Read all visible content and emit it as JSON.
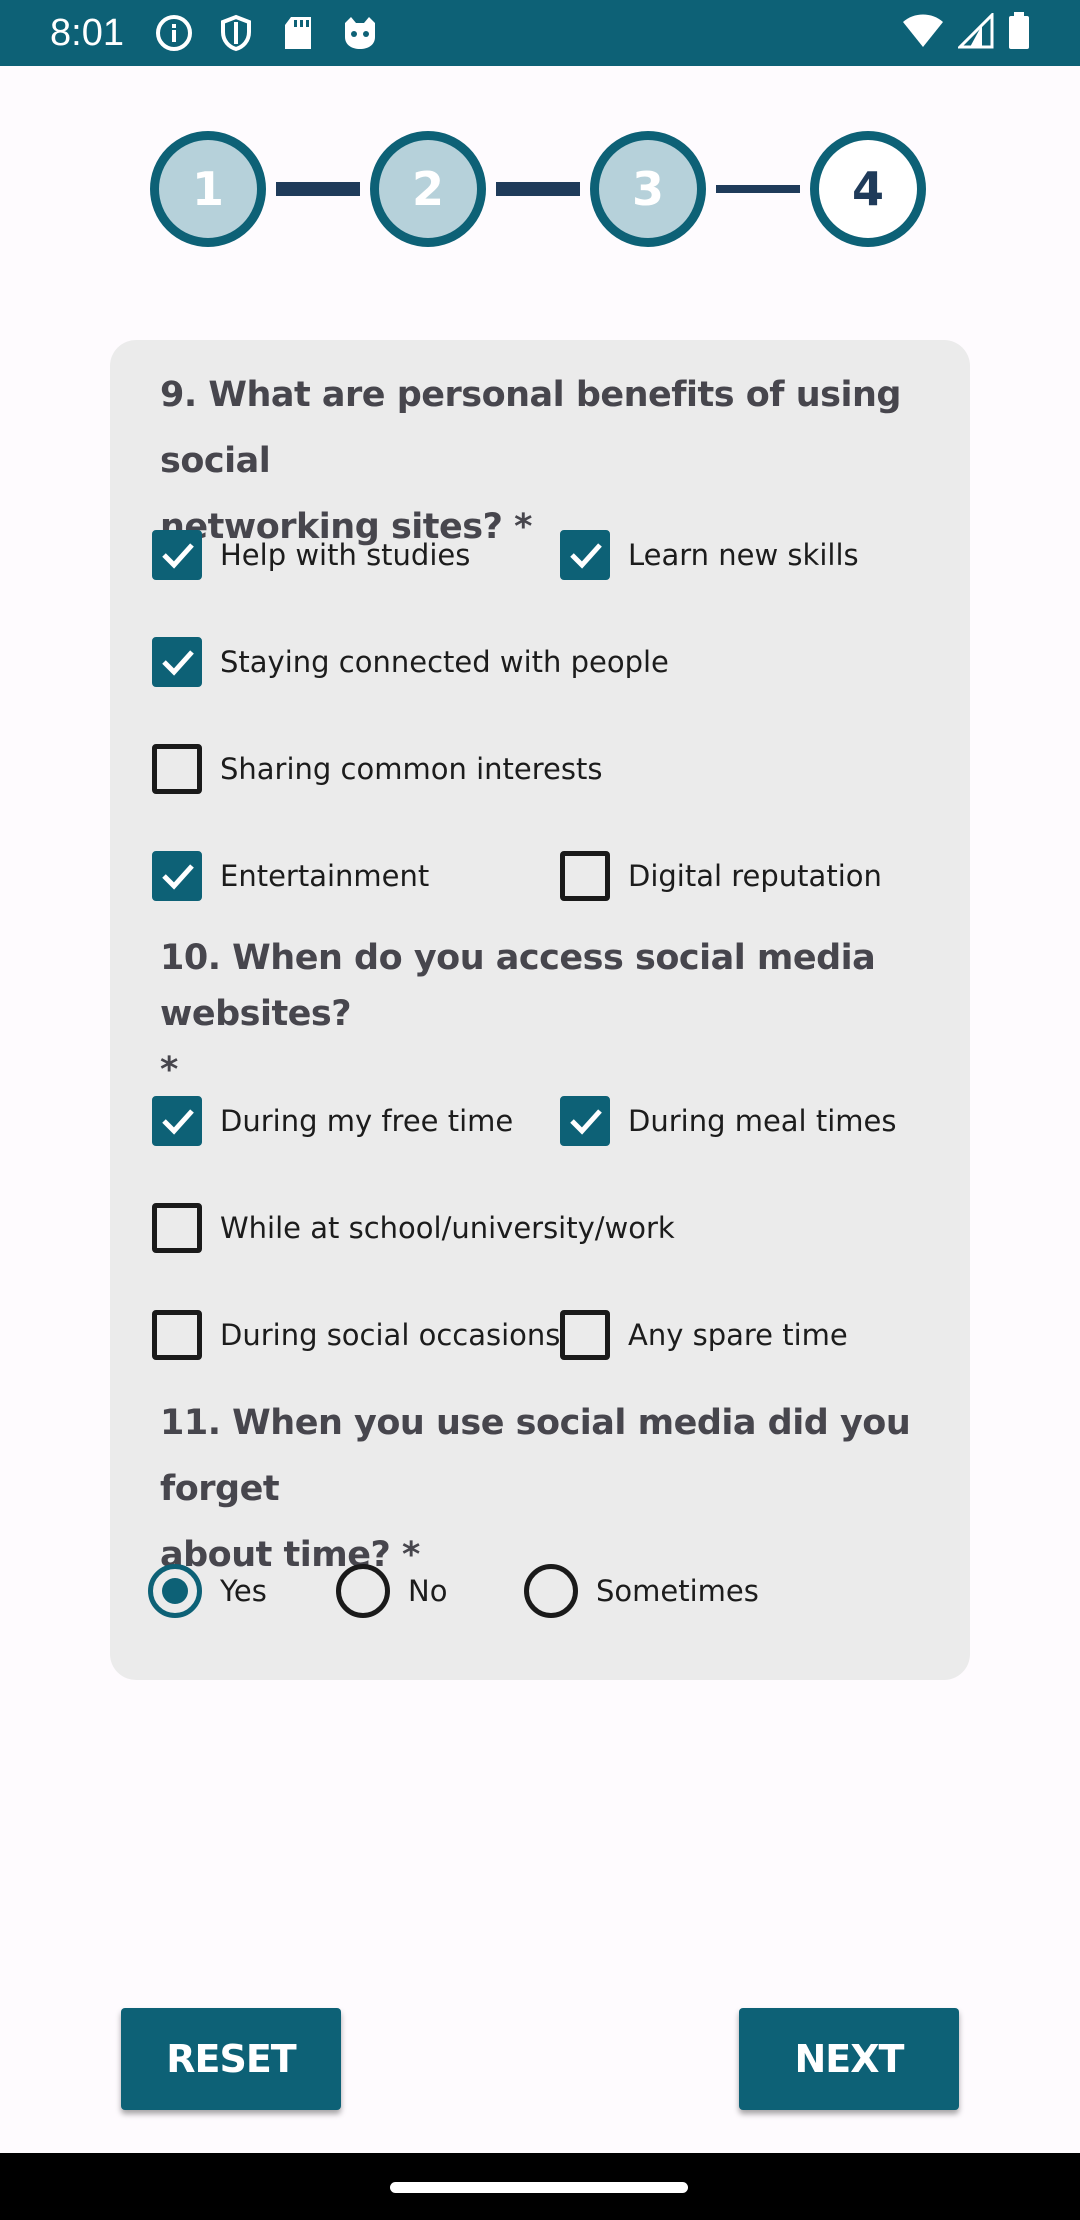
{
  "status_bar": {
    "time": "8:01",
    "left_icons": [
      "info-icon",
      "shield-icon",
      "sd-card-icon",
      "cat-face-icon"
    ],
    "right_icons": [
      "wifi-icon",
      "signal-icon",
      "battery-icon"
    ],
    "color": "#0d6176"
  },
  "stepper": {
    "steps": [
      {
        "label": "1",
        "state": "completed"
      },
      {
        "label": "2",
        "state": "completed"
      },
      {
        "label": "3",
        "state": "completed"
      },
      {
        "label": "4",
        "state": "active"
      }
    ]
  },
  "form": {
    "q9": {
      "line1": "9. What are personal benefits of using social",
      "line2": "networking sites? *",
      "options": [
        {
          "label": "Help with studies",
          "checked": true
        },
        {
          "label": "Learn new skills",
          "checked": true
        },
        {
          "label": "Staying connected with people",
          "checked": true
        },
        {
          "label": "Sharing common interests",
          "checked": false
        },
        {
          "label": "Entertainment",
          "checked": true
        },
        {
          "label": "Digital reputation",
          "checked": false
        }
      ]
    },
    "q10": {
      "line1": "10. When do you access social media websites?",
      "line2": "*",
      "options": [
        {
          "label": "During my free time",
          "checked": true
        },
        {
          "label": "During meal times",
          "checked": true
        },
        {
          "label": "While at school/university/work",
          "checked": false
        },
        {
          "label": "During social occasions",
          "checked": false
        },
        {
          "label": "Any spare time",
          "checked": false
        }
      ]
    },
    "q11": {
      "line1": "11. When you use social media did you forget",
      "line2": "about time? *",
      "options": [
        {
          "label": "Yes",
          "selected": true
        },
        {
          "label": "No",
          "selected": false
        },
        {
          "label": "Sometimes",
          "selected": false
        }
      ]
    }
  },
  "buttons": {
    "reset": "RESET",
    "next": "NEXT"
  },
  "colors": {
    "accent": "#0d6176",
    "step_fill": "#b6d1da",
    "connector": "#1f3b5a",
    "card_bg": "#ebebeb"
  }
}
